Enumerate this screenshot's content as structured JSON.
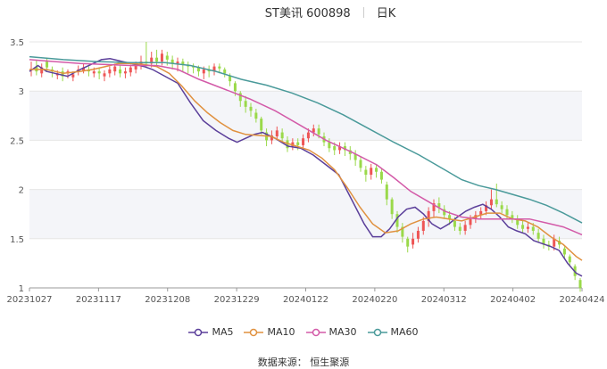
{
  "header": {
    "stock": "ST美讯 600898",
    "period": "日K"
  },
  "footer": {
    "source": "数据来源：  恒生聚源"
  },
  "chart_data": {
    "type": "line",
    "title": "ST美讯 600898",
    "xlabel": "",
    "ylabel": "",
    "ylim": [
      1,
      3.5
    ],
    "yticks": [
      1,
      1.5,
      2,
      2.5,
      3,
      3.5
    ],
    "x_ticks": [
      "20231027",
      "20231117",
      "20231208",
      "20231229",
      "20240122",
      "20240220",
      "20240312",
      "20240402",
      "20240424"
    ],
    "colors": {
      "up": "#ee5555",
      "down": "#9ad94a",
      "MA5": "#5b3f9a",
      "MA10": "#e0913f",
      "MA30": "#d35aa8",
      "MA60": "#4a9a9a"
    },
    "series": [
      {
        "name": "MA5",
        "points": [
          [
            0,
            3.2
          ],
          [
            10,
            3.26
          ],
          [
            20,
            3.2
          ],
          [
            30,
            3.18
          ],
          [
            45,
            3.15
          ],
          [
            60,
            3.22
          ],
          [
            75,
            3.28
          ],
          [
            85,
            3.32
          ],
          [
            95,
            3.33
          ],
          [
            110,
            3.3
          ],
          [
            125,
            3.27
          ],
          [
            135,
            3.25
          ],
          [
            145,
            3.22
          ],
          [
            160,
            3.15
          ],
          [
            175,
            3.08
          ],
          [
            190,
            2.88
          ],
          [
            205,
            2.7
          ],
          [
            220,
            2.6
          ],
          [
            235,
            2.52
          ],
          [
            245,
            2.48
          ],
          [
            255,
            2.52
          ],
          [
            265,
            2.56
          ],
          [
            275,
            2.58
          ],
          [
            290,
            2.52
          ],
          [
            305,
            2.44
          ],
          [
            320,
            2.42
          ],
          [
            335,
            2.35
          ],
          [
            350,
            2.25
          ],
          [
            365,
            2.15
          ],
          [
            380,
            1.9
          ],
          [
            395,
            1.65
          ],
          [
            405,
            1.52
          ],
          [
            415,
            1.52
          ],
          [
            425,
            1.6
          ],
          [
            435,
            1.72
          ],
          [
            445,
            1.8
          ],
          [
            455,
            1.82
          ],
          [
            465,
            1.75
          ],
          [
            475,
            1.65
          ],
          [
            485,
            1.6
          ],
          [
            495,
            1.65
          ],
          [
            505,
            1.72
          ],
          [
            515,
            1.78
          ],
          [
            525,
            1.82
          ],
          [
            535,
            1.85
          ],
          [
            545,
            1.8
          ],
          [
            555,
            1.72
          ],
          [
            565,
            1.62
          ],
          [
            575,
            1.58
          ],
          [
            585,
            1.55
          ],
          [
            595,
            1.48
          ],
          [
            605,
            1.45
          ],
          [
            615,
            1.42
          ],
          [
            625,
            1.38
          ],
          [
            635,
            1.25
          ],
          [
            645,
            1.15
          ],
          [
            652,
            1.12
          ]
        ]
      },
      {
        "name": "MA10",
        "points": [
          [
            0,
            3.22
          ],
          [
            20,
            3.22
          ],
          [
            40,
            3.18
          ],
          [
            60,
            3.2
          ],
          [
            75,
            3.22
          ],
          [
            90,
            3.25
          ],
          [
            105,
            3.28
          ],
          [
            120,
            3.28
          ],
          [
            135,
            3.27
          ],
          [
            150,
            3.25
          ],
          [
            165,
            3.18
          ],
          [
            180,
            3.05
          ],
          [
            195,
            2.9
          ],
          [
            210,
            2.78
          ],
          [
            225,
            2.68
          ],
          [
            240,
            2.6
          ],
          [
            255,
            2.56
          ],
          [
            270,
            2.55
          ],
          [
            285,
            2.54
          ],
          [
            300,
            2.48
          ],
          [
            315,
            2.44
          ],
          [
            330,
            2.4
          ],
          [
            345,
            2.32
          ],
          [
            360,
            2.2
          ],
          [
            375,
            2.02
          ],
          [
            390,
            1.82
          ],
          [
            405,
            1.65
          ],
          [
            420,
            1.56
          ],
          [
            435,
            1.58
          ],
          [
            450,
            1.65
          ],
          [
            465,
            1.7
          ],
          [
            480,
            1.72
          ],
          [
            495,
            1.7
          ],
          [
            510,
            1.68
          ],
          [
            525,
            1.72
          ],
          [
            540,
            1.76
          ],
          [
            555,
            1.76
          ],
          [
            570,
            1.7
          ],
          [
            585,
            1.68
          ],
          [
            600,
            1.62
          ],
          [
            615,
            1.52
          ],
          [
            630,
            1.44
          ],
          [
            645,
            1.32
          ],
          [
            652,
            1.28
          ]
        ]
      },
      {
        "name": "MA30",
        "points": [
          [
            0,
            3.32
          ],
          [
            30,
            3.3
          ],
          [
            60,
            3.28
          ],
          [
            90,
            3.27
          ],
          [
            120,
            3.26
          ],
          [
            150,
            3.26
          ],
          [
            175,
            3.22
          ],
          [
            200,
            3.12
          ],
          [
            230,
            3.02
          ],
          [
            260,
            2.92
          ],
          [
            290,
            2.8
          ],
          [
            320,
            2.65
          ],
          [
            350,
            2.5
          ],
          [
            380,
            2.38
          ],
          [
            410,
            2.25
          ],
          [
            430,
            2.12
          ],
          [
            450,
            1.98
          ],
          [
            470,
            1.88
          ],
          [
            490,
            1.78
          ],
          [
            510,
            1.72
          ],
          [
            530,
            1.7
          ],
          [
            550,
            1.7
          ],
          [
            570,
            1.7
          ],
          [
            590,
            1.7
          ],
          [
            610,
            1.66
          ],
          [
            630,
            1.62
          ],
          [
            652,
            1.54
          ]
        ]
      },
      {
        "name": "MA60",
        "points": [
          [
            0,
            3.35
          ],
          [
            40,
            3.32
          ],
          [
            80,
            3.3
          ],
          [
            120,
            3.29
          ],
          [
            160,
            3.29
          ],
          [
            190,
            3.26
          ],
          [
            220,
            3.2
          ],
          [
            250,
            3.12
          ],
          [
            280,
            3.06
          ],
          [
            310,
            2.98
          ],
          [
            340,
            2.88
          ],
          [
            370,
            2.76
          ],
          [
            400,
            2.62
          ],
          [
            430,
            2.48
          ],
          [
            460,
            2.35
          ],
          [
            490,
            2.2
          ],
          [
            510,
            2.1
          ],
          [
            530,
            2.04
          ],
          [
            550,
            2.0
          ],
          [
            570,
            1.95
          ],
          [
            590,
            1.9
          ],
          [
            610,
            1.84
          ],
          [
            630,
            1.76
          ],
          [
            652,
            1.66
          ]
        ]
      }
    ],
    "candles": [
      [
        0,
        3.22,
        3.22,
        3.3,
        3.15
      ],
      [
        3,
        3.25,
        3.2,
        3.32,
        3.16
      ],
      [
        6,
        3.18,
        3.24,
        3.28,
        3.14
      ],
      [
        9,
        3.3,
        3.24,
        3.34,
        3.2
      ],
      [
        12,
        3.22,
        3.2,
        3.25,
        3.14
      ],
      [
        15,
        3.16,
        3.18,
        3.21,
        3.12
      ],
      [
        18,
        3.2,
        3.15,
        3.24,
        3.1
      ],
      [
        21,
        3.18,
        3.2,
        3.22,
        3.13
      ],
      [
        24,
        3.14,
        3.17,
        3.2,
        3.1
      ],
      [
        27,
        3.2,
        3.22,
        3.26,
        3.16
      ],
      [
        30,
        3.21,
        3.24,
        3.28,
        3.18
      ],
      [
        33,
        3.22,
        3.2,
        3.25,
        3.15
      ],
      [
        36,
        3.18,
        3.2,
        3.24,
        3.14
      ],
      [
        39,
        3.2,
        3.18,
        3.24,
        3.12
      ],
      [
        42,
        3.15,
        3.18,
        3.21,
        3.1
      ],
      [
        45,
        3.18,
        3.22,
        3.25,
        3.14
      ],
      [
        48,
        3.2,
        3.25,
        3.28,
        3.16
      ],
      [
        51,
        3.22,
        3.18,
        3.26,
        3.14
      ],
      [
        54,
        3.18,
        3.2,
        3.24,
        3.13
      ],
      [
        57,
        3.19,
        3.24,
        3.27,
        3.15
      ],
      [
        60,
        3.22,
        3.26,
        3.3,
        3.18
      ],
      [
        63,
        3.26,
        3.3,
        3.36,
        3.22
      ],
      [
        66,
        3.3,
        3.28,
        3.5,
        3.24
      ],
      [
        69,
        3.28,
        3.34,
        3.4,
        3.24
      ],
      [
        72,
        3.34,
        3.3,
        3.42,
        3.25
      ],
      [
        75,
        3.3,
        3.38,
        3.42,
        3.26
      ],
      [
        78,
        3.36,
        3.32,
        3.4,
        3.26
      ],
      [
        81,
        3.32,
        3.28,
        3.36,
        3.22
      ],
      [
        84,
        3.28,
        3.3,
        3.34,
        3.2
      ],
      [
        87,
        3.3,
        3.27,
        3.33,
        3.2
      ],
      [
        90,
        3.27,
        3.25,
        3.3,
        3.18
      ],
      [
        93,
        3.25,
        3.24,
        3.28,
        3.18
      ],
      [
        96,
        3.24,
        3.2,
        3.26,
        3.15
      ],
      [
        99,
        3.18,
        3.22,
        3.25,
        3.12
      ],
      [
        102,
        3.22,
        3.2,
        3.26,
        3.14
      ],
      [
        105,
        3.2,
        3.25,
        3.28,
        3.16
      ],
      [
        108,
        3.25,
        3.23,
        3.28,
        3.18
      ],
      [
        111,
        3.22,
        3.18,
        3.24,
        3.14
      ],
      [
        114,
        3.16,
        3.1,
        3.18,
        3.05
      ],
      [
        117,
        3.08,
        3.0,
        3.1,
        2.95
      ],
      [
        120,
        2.98,
        2.9,
        3.0,
        2.84
      ],
      [
        123,
        2.9,
        2.84,
        2.95,
        2.78
      ],
      [
        126,
        2.84,
        2.8,
        2.88,
        2.74
      ],
      [
        129,
        2.78,
        2.72,
        2.82,
        2.68
      ],
      [
        132,
        2.72,
        2.6,
        2.74,
        2.56
      ],
      [
        135,
        2.58,
        2.5,
        2.62,
        2.44
      ],
      [
        138,
        2.5,
        2.55,
        2.6,
        2.46
      ],
      [
        141,
        2.54,
        2.6,
        2.64,
        2.5
      ],
      [
        144,
        2.58,
        2.52,
        2.62,
        2.48
      ],
      [
        147,
        2.5,
        2.42,
        2.54,
        2.38
      ],
      [
        150,
        2.44,
        2.48,
        2.52,
        2.4
      ],
      [
        153,
        2.48,
        2.45,
        2.52,
        2.4
      ],
      [
        156,
        2.45,
        2.52,
        2.56,
        2.42
      ],
      [
        159,
        2.52,
        2.58,
        2.62,
        2.48
      ],
      [
        162,
        2.58,
        2.62,
        2.66,
        2.54
      ],
      [
        165,
        2.62,
        2.56,
        2.66,
        2.52
      ],
      [
        168,
        2.54,
        2.48,
        2.58,
        2.44
      ],
      [
        171,
        2.48,
        2.42,
        2.52,
        2.38
      ],
      [
        174,
        2.44,
        2.4,
        2.48,
        2.35
      ],
      [
        177,
        2.4,
        2.44,
        2.48,
        2.36
      ],
      [
        180,
        2.44,
        2.4,
        2.48,
        2.34
      ],
      [
        183,
        2.4,
        2.36,
        2.44,
        2.3
      ],
      [
        186,
        2.36,
        2.3,
        2.4,
        2.24
      ],
      [
        189,
        2.3,
        2.22,
        2.34,
        2.18
      ],
      [
        192,
        2.2,
        2.15,
        2.24,
        2.08
      ],
      [
        195,
        2.15,
        2.22,
        2.26,
        2.1
      ],
      [
        198,
        2.22,
        2.18,
        2.26,
        2.12
      ],
      [
        201,
        2.18,
        2.1,
        2.22,
        2.06
      ],
      [
        204,
        2.05,
        1.9,
        2.08,
        1.84
      ],
      [
        207,
        1.9,
        1.75,
        1.92,
        1.7
      ],
      [
        210,
        1.75,
        1.62,
        1.78,
        1.56
      ],
      [
        213,
        1.62,
        1.52,
        1.66,
        1.46
      ],
      [
        216,
        1.5,
        1.42,
        1.52,
        1.36
      ],
      [
        219,
        1.44,
        1.5,
        1.56,
        1.4
      ],
      [
        222,
        1.5,
        1.58,
        1.62,
        1.46
      ],
      [
        225,
        1.58,
        1.68,
        1.72,
        1.54
      ],
      [
        228,
        1.68,
        1.78,
        1.82,
        1.62
      ],
      [
        231,
        1.78,
        1.86,
        1.9,
        1.72
      ],
      [
        234,
        1.86,
        1.82,
        1.92,
        1.76
      ],
      [
        237,
        1.8,
        1.74,
        1.84,
        1.7
      ],
      [
        240,
        1.74,
        1.7,
        1.78,
        1.64
      ],
      [
        243,
        1.68,
        1.62,
        1.72,
        1.58
      ],
      [
        246,
        1.62,
        1.58,
        1.66,
        1.54
      ],
      [
        249,
        1.58,
        1.64,
        1.68,
        1.54
      ],
      [
        252,
        1.64,
        1.7,
        1.74,
        1.6
      ],
      [
        255,
        1.7,
        1.74,
        1.78,
        1.66
      ],
      [
        258,
        1.74,
        1.78,
        1.82,
        1.7
      ],
      [
        261,
        1.78,
        1.84,
        1.88,
        1.74
      ],
      [
        264,
        1.84,
        1.9,
        2.0,
        1.8
      ],
      [
        267,
        1.9,
        1.85,
        2.06,
        1.82
      ],
      [
        270,
        1.84,
        1.8,
        1.88,
        1.76
      ],
      [
        273,
        1.8,
        1.74,
        1.84,
        1.7
      ],
      [
        276,
        1.74,
        1.7,
        1.78,
        1.66
      ],
      [
        279,
        1.7,
        1.64,
        1.74,
        1.6
      ],
      [
        282,
        1.64,
        1.6,
        1.68,
        1.56
      ],
      [
        285,
        1.6,
        1.62,
        1.66,
        1.56
      ],
      [
        288,
        1.62,
        1.58,
        1.66,
        1.54
      ],
      [
        291,
        1.56,
        1.5,
        1.6,
        1.46
      ],
      [
        294,
        1.5,
        1.44,
        1.54,
        1.4
      ],
      [
        297,
        1.44,
        1.42,
        1.48,
        1.38
      ],
      [
        300,
        1.42,
        1.5,
        1.54,
        1.38
      ],
      [
        303,
        1.48,
        1.44,
        1.52,
        1.4
      ],
      [
        306,
        1.4,
        1.34,
        1.42,
        1.3
      ],
      [
        309,
        1.32,
        1.26,
        1.34,
        1.22
      ],
      [
        312,
        1.22,
        1.12,
        1.24,
        1.08
      ],
      [
        315,
        1.08,
        1.0,
        1.1,
        0.96
      ]
    ]
  }
}
